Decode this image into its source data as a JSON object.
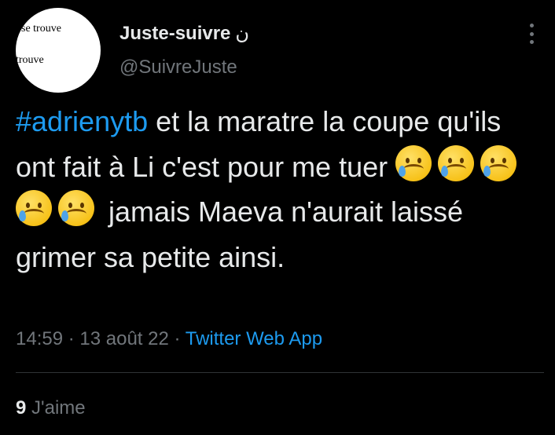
{
  "author": {
    "avatar_text_1": "ose trouve",
    "avatar_text_2": "trouve",
    "display_name": "Juste-suivre",
    "name_mark": "ن",
    "handle": "@SuivreJuste"
  },
  "tweet": {
    "hashtag": "#adrienytb",
    "text_1": " et la maratre la coupe qu'ils ont fait à Li c'est pour me tuer ",
    "emoji_name": "sad-but-relieved-face",
    "emoji_count": 5,
    "text_2": " jamais Maeva n'aurait laissé grimer sa petite ainsi."
  },
  "meta": {
    "time": "14:59",
    "sep1": " · ",
    "date": "13 août 22",
    "sep2": " · ",
    "source": "Twitter Web App"
  },
  "stats": {
    "likes_count": "9",
    "likes_label": "J'aime"
  },
  "colors": {
    "background": "#000000",
    "text": "#e7e9ea",
    "secondary": "#71767b",
    "accent": "#1d9bf0",
    "divider": "#2f3336"
  }
}
